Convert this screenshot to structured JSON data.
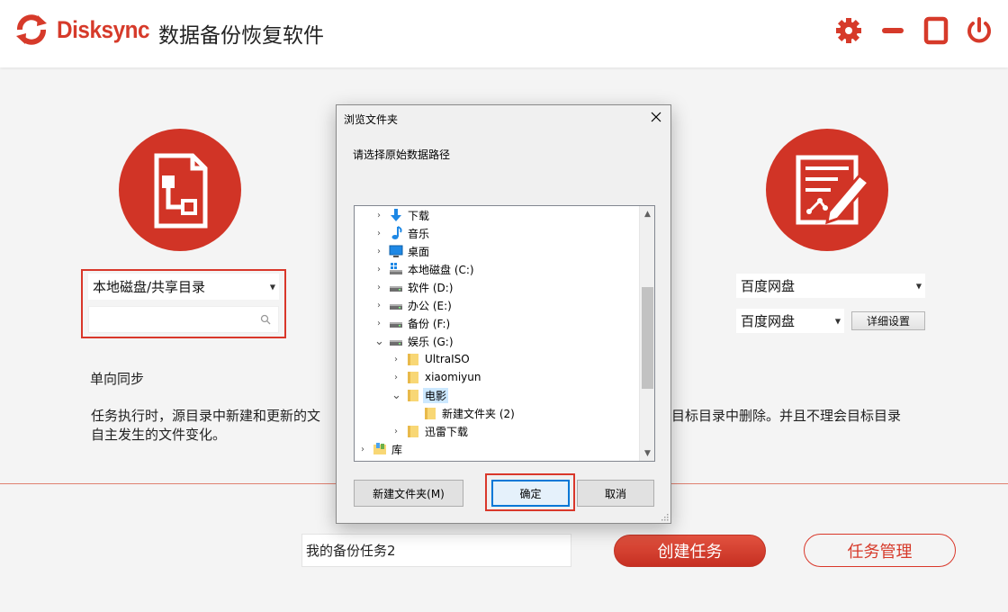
{
  "header": {
    "brand": "Disksync",
    "subtitle": "数据备份恢复软件",
    "accent": "#d63a2a",
    "icons": [
      "sync-logo-icon",
      "gear-icon",
      "minimize-icon",
      "maximize-icon",
      "power-icon"
    ]
  },
  "source": {
    "type_select": "本地磁盘/共享目录",
    "path_value": "",
    "icon": "document-flow-icon"
  },
  "target": {
    "type_select": "百度网盘",
    "account_select": "百度网盘",
    "detail_button": "详细设置",
    "icon": "edit-note-icon"
  },
  "mode": {
    "label": "单向同步",
    "desc_left_1": "任务执行时，源目录中新建和更新的文",
    "desc_left_2": "自主发生的文件变化。",
    "desc_right_1": "目标目录中删除。并且不理会目标目录"
  },
  "bottom": {
    "task_name": "我的备份任务2",
    "create_button": "创建任务",
    "manage_button": "任务管理"
  },
  "dialog": {
    "title": "浏览文件夹",
    "prompt": "请选择原始数据路径",
    "tree": [
      {
        "label": "下载",
        "icon": "download-arrow-icon",
        "level": 1,
        "state": "collapsed"
      },
      {
        "label": "音乐",
        "icon": "music-note-icon",
        "level": 1,
        "state": "collapsed"
      },
      {
        "label": "桌面",
        "icon": "desktop-icon",
        "level": 1,
        "state": "collapsed"
      },
      {
        "label": "本地磁盘 (C:)",
        "icon": "system-drive-icon",
        "level": 1,
        "state": "collapsed"
      },
      {
        "label": "软件 (D:)",
        "icon": "drive-icon",
        "level": 1,
        "state": "collapsed"
      },
      {
        "label": "办公 (E:)",
        "icon": "drive-icon",
        "level": 1,
        "state": "collapsed"
      },
      {
        "label": "备份 (F:)",
        "icon": "drive-icon",
        "level": 1,
        "state": "collapsed"
      },
      {
        "label": "娱乐 (G:)",
        "icon": "drive-icon",
        "level": 1,
        "state": "expanded"
      },
      {
        "label": "UltraISO",
        "icon": "folder-icon",
        "level": 2,
        "state": "collapsed"
      },
      {
        "label": "xiaomiyun",
        "icon": "folder-icon",
        "level": 2,
        "state": "collapsed"
      },
      {
        "label": "电影",
        "icon": "folder-icon",
        "level": 2,
        "state": "expanded"
      },
      {
        "label": "新建文件夹 (2)",
        "icon": "folder-icon",
        "level": 3,
        "state": "none"
      },
      {
        "label": "迅雷下载",
        "icon": "folder-icon",
        "level": 2,
        "state": "collapsed"
      },
      {
        "label": "库",
        "icon": "library-icon",
        "level": 0,
        "state": "collapsed"
      }
    ],
    "new_folder_button": "新建文件夹(M)",
    "ok_button": "确定",
    "cancel_button": "取消"
  }
}
